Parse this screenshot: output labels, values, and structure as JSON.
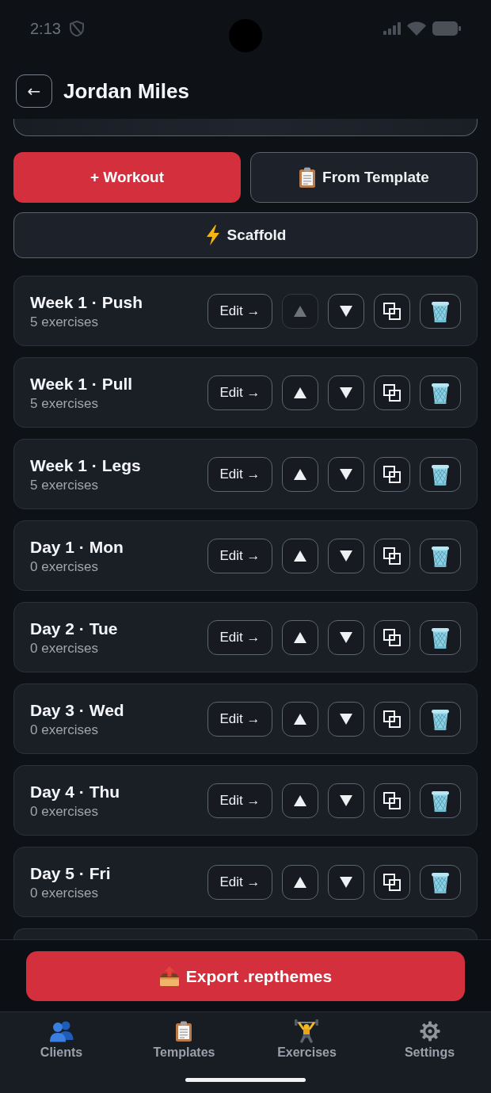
{
  "status_bar": {
    "time": "2:13"
  },
  "header": {
    "back_button": "←",
    "title": "Jordan Miles"
  },
  "actions": [
    {
      "kind": "primary",
      "label": "+ Workout"
    },
    {
      "kind": "secondary",
      "label": "From Template"
    },
    {
      "kind": "secondary",
      "label": "Scaffold"
    }
  ],
  "workouts": [
    {
      "title": "Week 1 · Push",
      "subtitle": "5 exercises",
      "edit_button": "Edit →",
      "move_up_disabled": true
    },
    {
      "title": "Week 1 · Pull",
      "subtitle": "5 exercises",
      "edit_button": "Edit →",
      "move_up_disabled": false
    },
    {
      "title": "Week 1 · Legs",
      "subtitle": "5 exercises",
      "edit_button": "Edit →",
      "move_up_disabled": false
    },
    {
      "title": "Day 1 · Mon",
      "subtitle": "0 exercises",
      "edit_button": "Edit →",
      "move_up_disabled": false
    },
    {
      "title": "Day 2 · Tue",
      "subtitle": "0 exercises",
      "edit_button": "Edit →",
      "move_up_disabled": false
    },
    {
      "title": "Day 3 · Wed",
      "subtitle": "0 exercises",
      "edit_button": "Edit →",
      "move_up_disabled": false
    },
    {
      "title": "Day 4 · Thu",
      "subtitle": "0 exercises",
      "edit_button": "Edit →",
      "move_up_disabled": false
    },
    {
      "title": "Day 5 · Fri",
      "subtitle": "0 exercises",
      "edit_button": "Edit →",
      "move_up_disabled": false
    }
  ],
  "export_button": {
    "label": "Export .repthemes"
  },
  "tab_bar": [
    {
      "label": "Clients",
      "selected": false
    },
    {
      "label": "Templates",
      "selected": false
    },
    {
      "label": "Exercises",
      "selected": false
    },
    {
      "label": "Settings",
      "selected": false
    }
  ]
}
